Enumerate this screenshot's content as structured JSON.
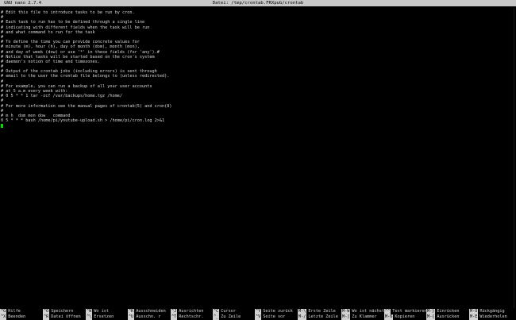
{
  "titlebar": {
    "app": "GNU nano 2.7.4",
    "file": "Datei: /tmp/crontab.FRXpuG/crontab"
  },
  "editor": {
    "lines": [
      "# Edit this file to introduce tasks to be run by cron.",
      "#",
      "# Each task to run has to be defined through a single line",
      "# indicating with different fields when the task will be run",
      "# and what command to run for the task",
      "#",
      "# To define the time you can provide concrete values for",
      "# minute (m), hour (h), day of month (dom), month (mon),",
      "# and day of week (dow) or use '*' in these fields (for 'any').#",
      "# Notice that tasks will be started based on the cron's system",
      "# daemon's notion of time and timezones.",
      "#",
      "# Output of the crontab jobs (including errors) is sent through",
      "# email to the user the crontab file belongs to (unless redirected).",
      "#",
      "# For example, you can run a backup of all your user accounts",
      "# at 5 a.m every week with:",
      "# 0 5 * * 1 tar -zcf /var/backups/home.tgz /home/",
      "#",
      "# For more information see the manual pages of crontab(5) and cron(8)",
      "#",
      "# m h  dom mon dow   command",
      "0 5 * * * bash /home/pi/youtube-upload.sh > /home/pi/cron.log 2>&1",
      ""
    ],
    "cursor_color": "#00e000"
  },
  "shortcuts": {
    "row1": [
      {
        "key": "^G",
        "label": "Hilfe"
      },
      {
        "key": "^O",
        "label": "Speichern"
      },
      {
        "key": "^W",
        "label": "Wo ist"
      },
      {
        "key": "^K",
        "label": "Ausschneiden"
      },
      {
        "key": "^J",
        "label": "Ausrichten"
      },
      {
        "key": "^C",
        "label": "Cursor"
      },
      {
        "key": "^Y",
        "label": "Seite zurück"
      },
      {
        "key": "M-\\",
        "label": "Erste Zeile"
      },
      {
        "key": "M-W",
        "label": "Wo ist nächst"
      },
      {
        "key": "^^",
        "label": "Text markieren"
      },
      {
        "key": "M-}",
        "label": "Einrücken"
      },
      {
        "key": "M-U",
        "label": "Rückgängig"
      }
    ],
    "row2": [
      {
        "key": "^X",
        "label": "Beenden"
      },
      {
        "key": "^R",
        "label": "Datei öffnen"
      },
      {
        "key": "^\\",
        "label": "Ersetzen"
      },
      {
        "key": "^U",
        "label": "Ausschn. r"
      },
      {
        "key": "^T",
        "label": "Rechtschr."
      },
      {
        "key": "^_",
        "label": "Zu Zeile"
      },
      {
        "key": "^V",
        "label": "Seite vor"
      },
      {
        "key": "M-/",
        "label": "Letzte Zeile"
      },
      {
        "key": "M-]",
        "label": "Zu Klammer"
      },
      {
        "key": "M-6",
        "label": "Kopieren"
      },
      {
        "key": "M-{",
        "label": "Ausrücken"
      },
      {
        "key": "M-E",
        "label": "Wiederholen"
      }
    ]
  }
}
